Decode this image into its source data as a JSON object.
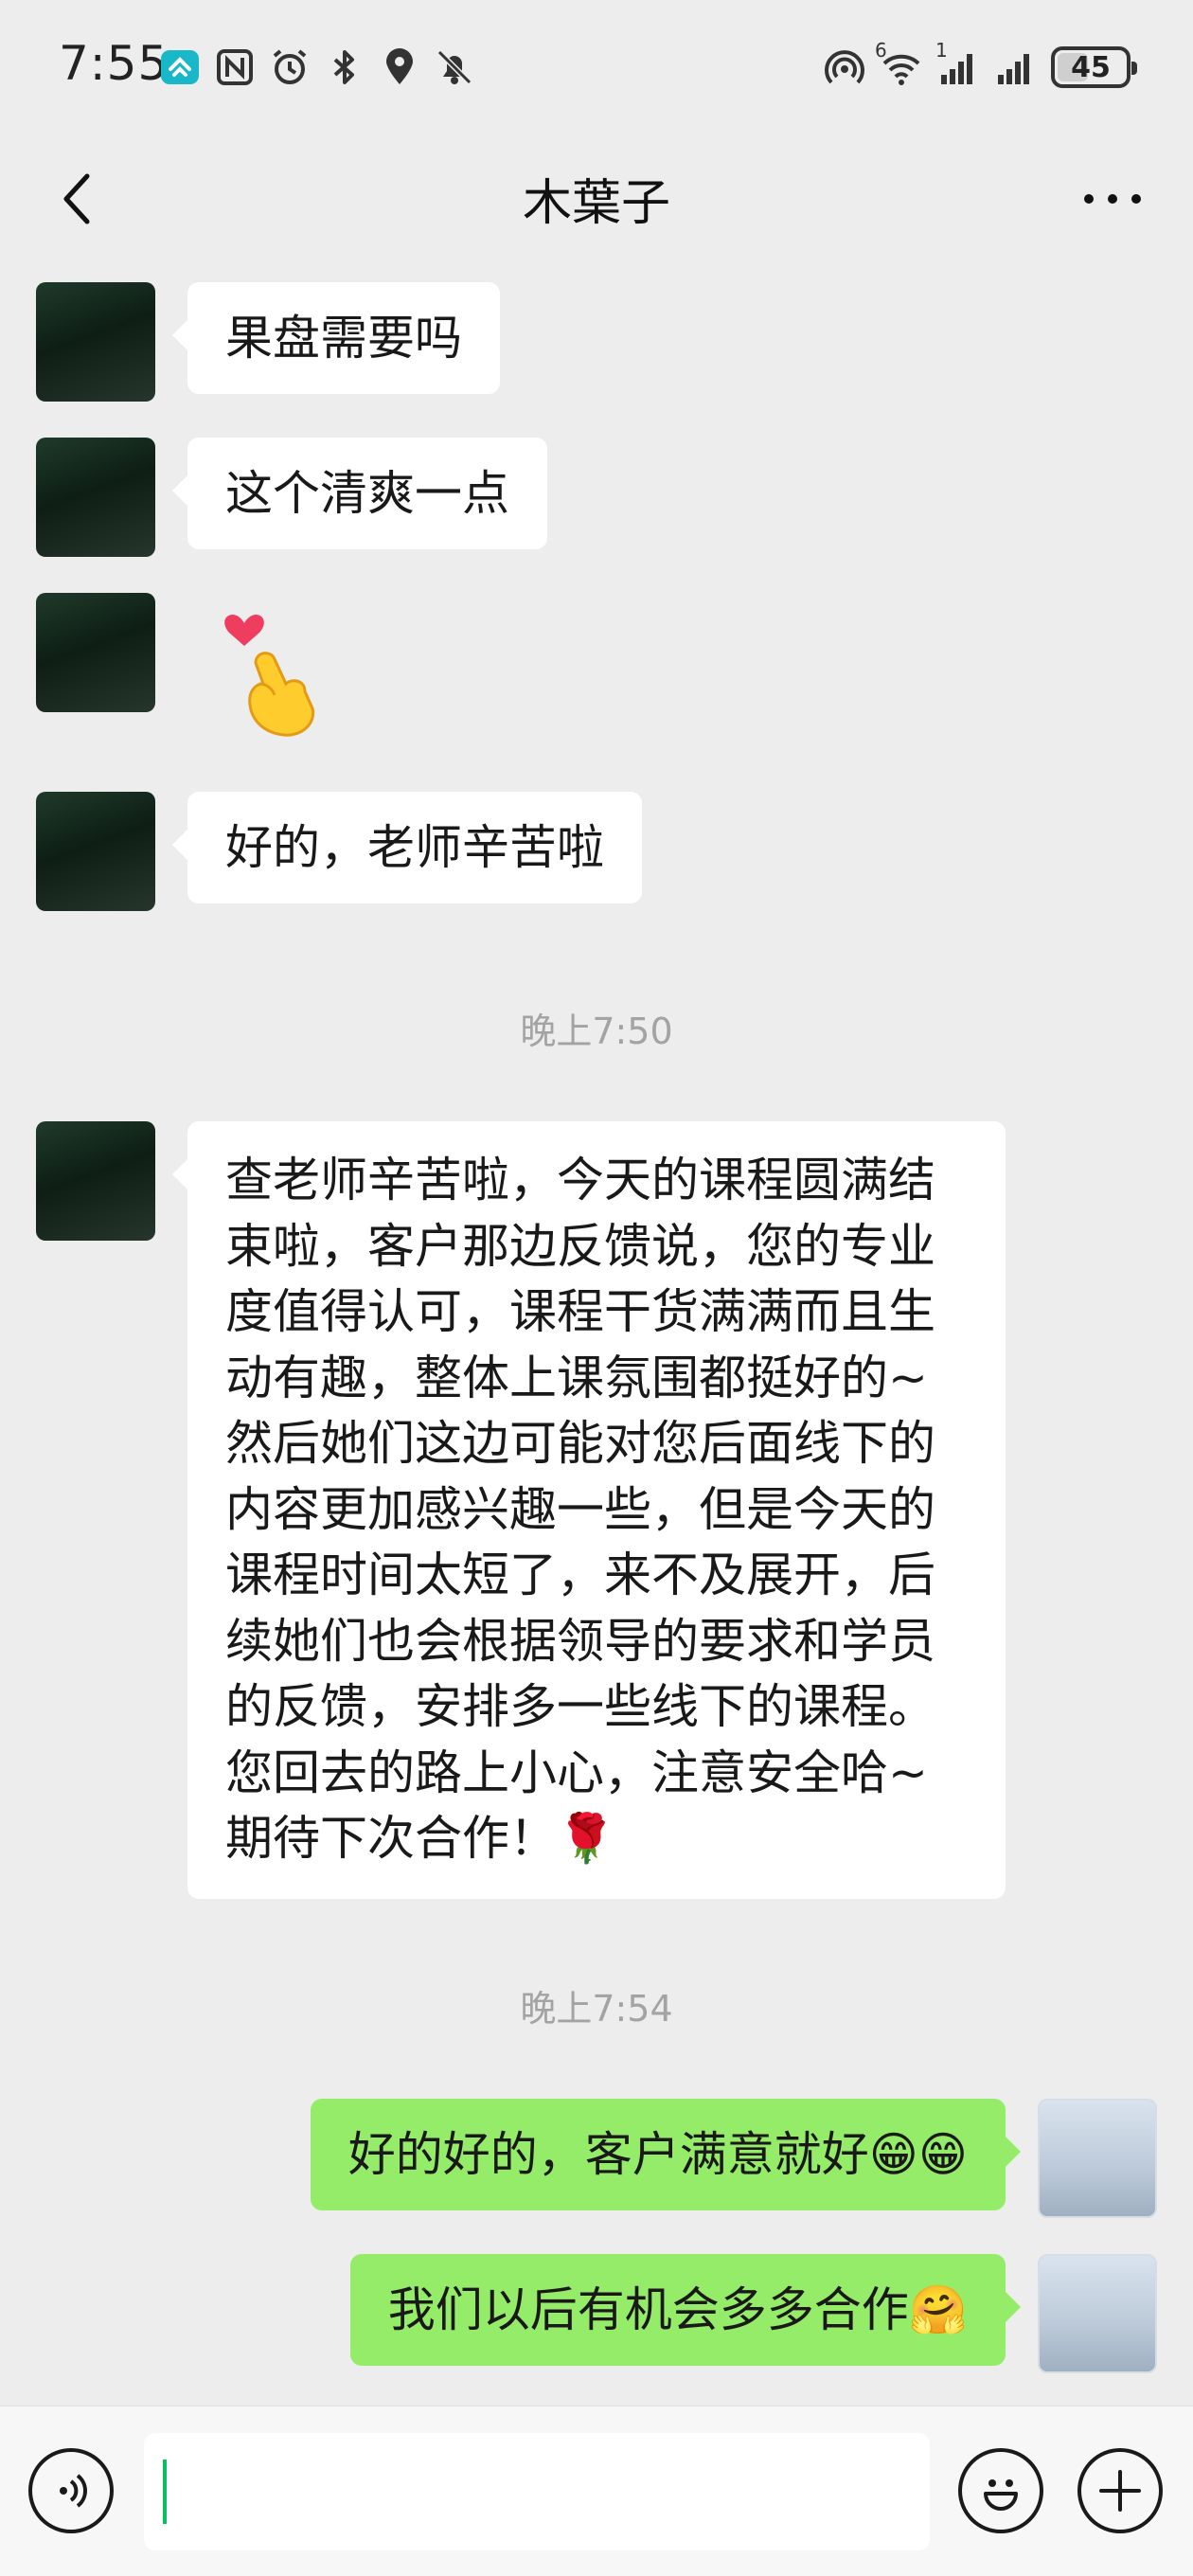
{
  "status_bar": {
    "time": "7:55",
    "battery": "45",
    "battery_level": 0.45,
    "signal_superscript": "1",
    "wifi_superscript": "6",
    "left_icons": [
      "app-badge-icon",
      "nfc-icon",
      "alarm-icon",
      "bluetooth-icon",
      "location-icon",
      "mute-bell-icon"
    ],
    "right_icons": [
      "hotspot-icon",
      "wifi-icon",
      "cell-signal-1-icon",
      "cell-signal-2-icon",
      "battery-icon"
    ]
  },
  "nav": {
    "title": "木葉子",
    "back_icon": "chevron-left-icon",
    "more_icon": "more-dots-icon"
  },
  "messages": [
    {
      "direction": "in",
      "text": "果盘需要吗"
    },
    {
      "direction": "in",
      "text": "这个清爽一点"
    },
    {
      "direction": "in",
      "sticker": "heart-finger-emoji"
    },
    {
      "direction": "in",
      "text": "好的，老师辛苦啦"
    },
    {
      "timestamp": "晚上7:50"
    },
    {
      "direction": "in",
      "lines": [
        "查老师辛苦啦，今天的课程圆满结",
        "束啦，客户那边反馈说，您的专业",
        "度值得认可，课程干货满满而且生",
        "动有趣，整体上课氛围都挺好的~",
        "然后她们这边可能对您后面线下的",
        "内容更加感兴趣一些，但是今天的",
        "课程时间太短了，来不及展开，后",
        "续她们也会根据领导的要求和学员",
        "的反馈，安排多一些线下的课程。",
        "您回去的路上小心，注意安全哈~",
        "期待下次合作！🌹"
      ]
    },
    {
      "timestamp": "晚上7:54"
    },
    {
      "direction": "out",
      "text": "好的好的，客户满意就好😁😁"
    },
    {
      "direction": "out",
      "text": "我们以后有机会多多合作🤗"
    }
  ],
  "input_bar": {
    "placeholder": "",
    "value": "",
    "voice_icon": "voice-icon",
    "emoji_icon": "emoji-icon",
    "plus_icon": "plus-icon"
  },
  "colors": {
    "background": "#ededed",
    "bubble_in": "#ffffff",
    "bubble_out": "#95ec69",
    "caret": "#07c160",
    "timestamp": "#a3a3a3"
  }
}
